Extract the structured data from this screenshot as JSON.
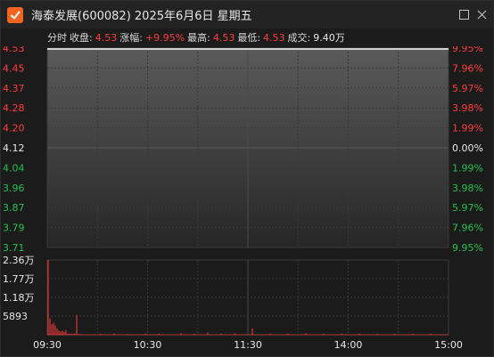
{
  "window": {
    "title": "海泰发展(600082) 2025年6月6日 星期五",
    "maximize_icon": "maximize-icon",
    "close_icon": "close-icon",
    "app_icon": "check-logo-icon"
  },
  "info": {
    "mode": "分时",
    "close_label": "收盘:",
    "close_value": "4.53",
    "change_label": "涨幅:",
    "change_value": "+9.95%",
    "high_label": "最高:",
    "high_value": "4.53",
    "low_label": "最低:",
    "low_value": "4.53",
    "volume_label": "成交:",
    "volume_value": "9.40万"
  },
  "colors": {
    "up": "#ff3b3b",
    "down": "#22c04a",
    "neutral": "#e8e8e8",
    "price_line": "#ffffff",
    "volume_bar": "#ff3b3b"
  },
  "chart_data": {
    "type": "line",
    "price_axis": {
      "ticks": [
        "4.53",
        "4.45",
        "4.37",
        "4.28",
        "4.20",
        "4.12",
        "4.04",
        "3.96",
        "3.87",
        "3.79",
        "3.71"
      ],
      "ylim": [
        3.71,
        4.53
      ]
    },
    "percent_axis": {
      "ticks": [
        "9.95%",
        "7.96%",
        "5.97%",
        "3.98%",
        "1.99%",
        "0.00%",
        "1.99%",
        "3.98%",
        "5.97%",
        "7.96%",
        "9.95%"
      ]
    },
    "volume_axis": {
      "ticks": [
        "2.36万",
        "1.77万",
        "1.18万",
        "5893"
      ],
      "max": 23600
    },
    "time_axis": {
      "ticks": [
        "09:30",
        "10:30",
        "11:30",
        "14:00",
        "15:00"
      ]
    },
    "price_series": {
      "name": "",
      "points": [
        [
          "09:30",
          4.53
        ],
        [
          "15:00",
          4.53
        ]
      ]
    },
    "volume_series": {
      "values": [
        23600,
        5200,
        3300,
        3800,
        2900,
        2000,
        1300,
        1100,
        1200,
        900,
        1500,
        400,
        300,
        300,
        250,
        300,
        6300,
        200,
        150,
        150
      ]
    }
  }
}
